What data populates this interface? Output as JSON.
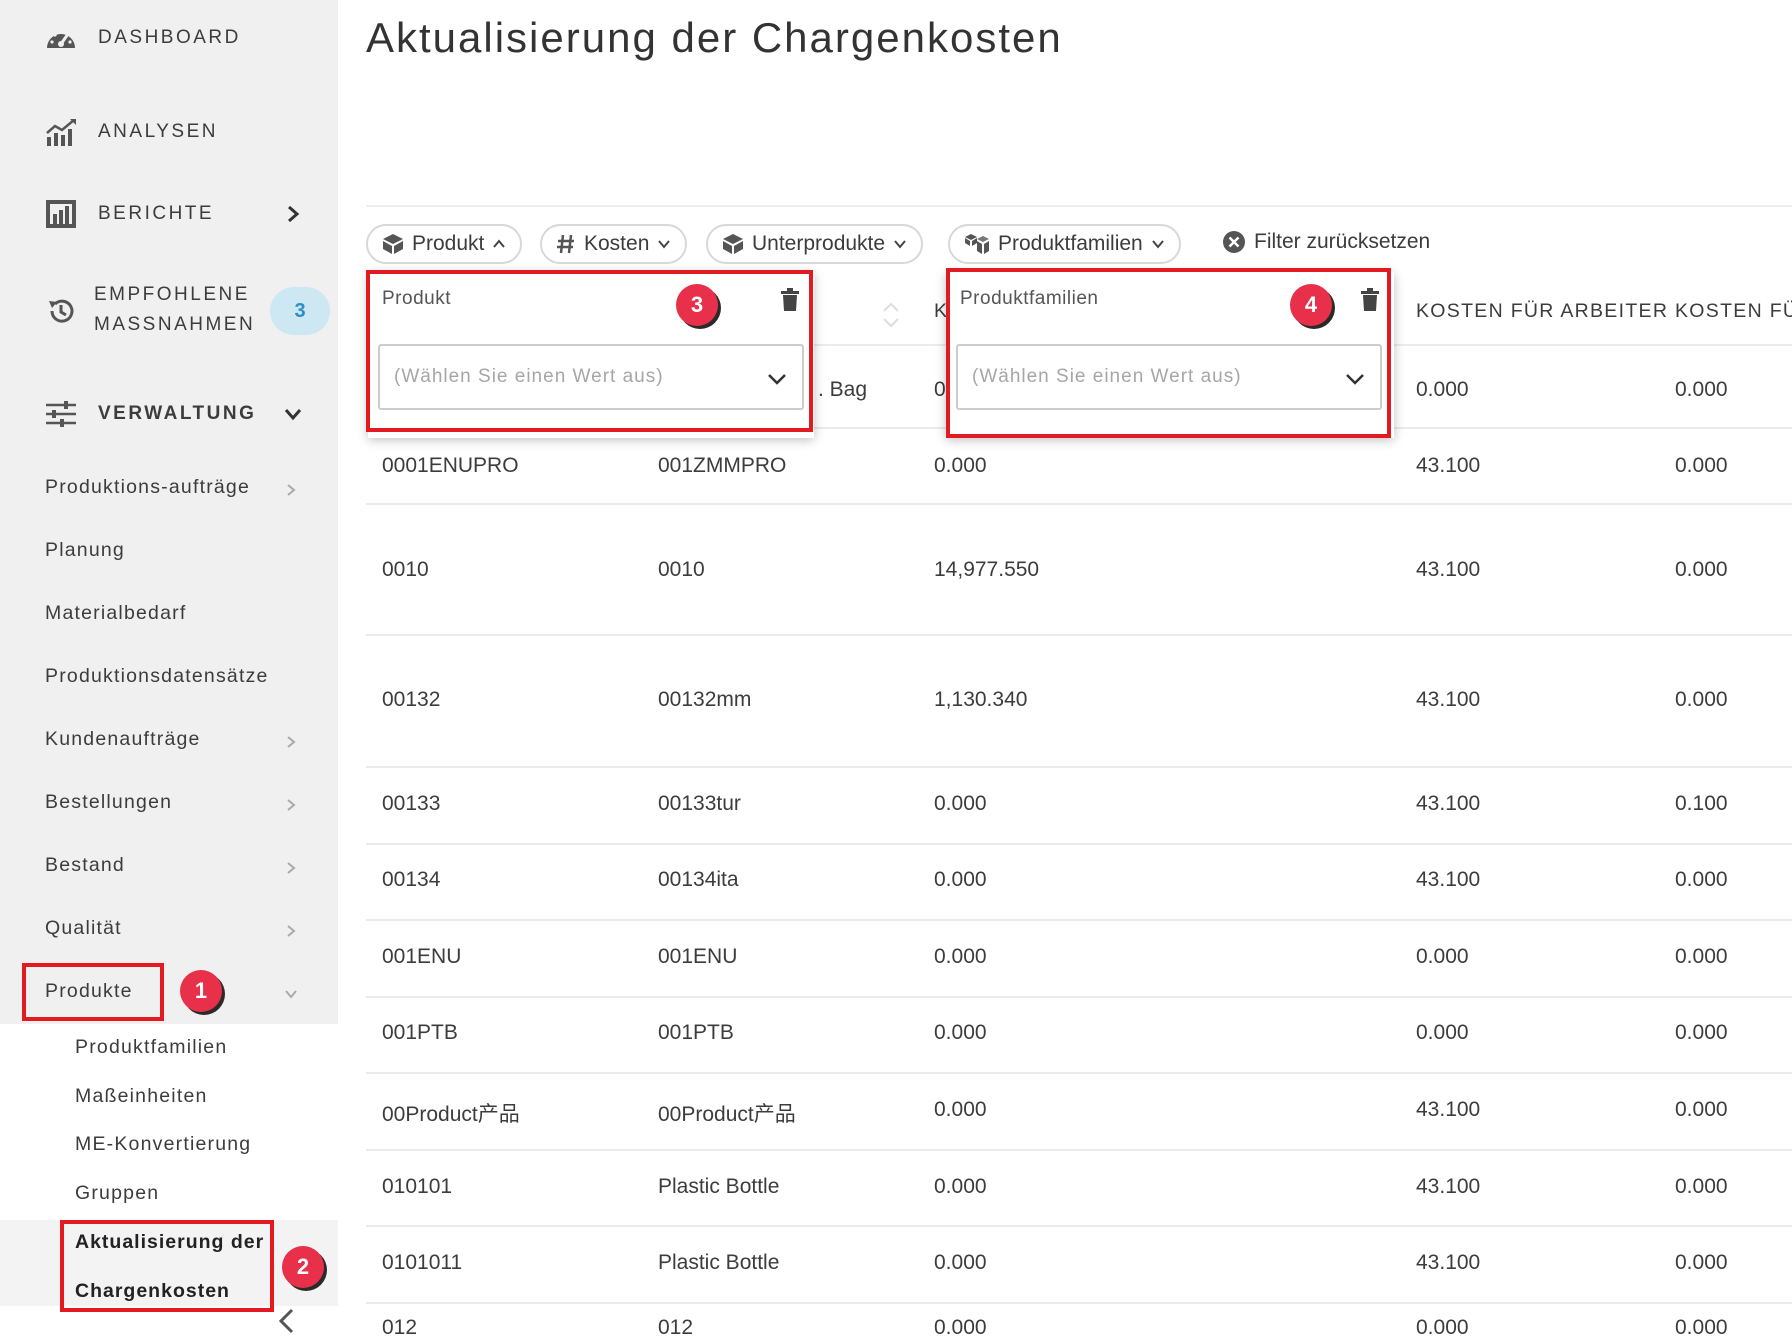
{
  "page": {
    "title": "Aktualisierung der Chargenkosten"
  },
  "sidebar": {
    "top_items": [
      {
        "label": "DASHBOARD",
        "icon": "gauge-icon"
      },
      {
        "label": "ANALYSEN",
        "icon": "analytics-icon"
      },
      {
        "label": "BERICHTE",
        "icon": "reports-icon"
      },
      {
        "label_line1": "EMPFOHLENE",
        "label_line2": "MASSNAHMEN",
        "icon": "history-icon",
        "badge": "3"
      },
      {
        "label": "VERWALTUNG",
        "icon": "sliders-icon"
      }
    ],
    "items": [
      "Produktions-aufträge",
      "Planung",
      "Materialbedarf",
      "Produktionsdatensätze",
      "Kundenaufträge",
      "Bestellungen",
      "Bestand",
      "Qualität",
      "Produkte"
    ],
    "sub_items": [
      "Produktfamilien",
      "Maßeinheiten",
      "ME-Konvertierung",
      "Gruppen"
    ],
    "active_sub_line1": "Aktualisierung der",
    "active_sub_line2": "Chargenkosten"
  },
  "filters": {
    "chips": [
      {
        "label": "Produkt",
        "icon": "cube-icon",
        "state": "expanded"
      },
      {
        "label": "Kosten",
        "icon": "hash-icon",
        "state": "collapsed"
      },
      {
        "label": "Unterprodukte",
        "icon": "cube-icon",
        "state": "collapsed"
      },
      {
        "label": "Produktfamilien",
        "icon": "cubes-icon",
        "state": "collapsed"
      }
    ],
    "reset_label": "Filter zurücksetzen"
  },
  "popovers": {
    "produkt": {
      "title": "Produkt",
      "placeholder": "(Wählen Sie einen Wert aus)"
    },
    "produktfamilien": {
      "title": "Produktfamilien",
      "placeholder": "(Wählen Sie einen Wert aus)"
    }
  },
  "table": {
    "headers": {
      "col3_fragment": "K",
      "col4": "KOSTEN FÜR ARBEITER",
      "col5": "KOSTEN FÜR"
    },
    "first_row": {
      "col2_fragment": ". Bag",
      "col3_fragment": "0",
      "col4": "0.000",
      "col5": "0.000"
    },
    "rows": [
      {
        "c1": "0001ENUPRO",
        "c2": "001ZMMPRO",
        "c3": "0.000",
        "c4": "43.100",
        "c5": "0.000"
      },
      {
        "c1": "0010",
        "c2": "0010",
        "c3": "14,977.550",
        "c4": "43.100",
        "c5": "0.000"
      },
      {
        "c1": "00132",
        "c2": "00132mm",
        "c3": "1,130.340",
        "c4": "43.100",
        "c5": "0.000"
      },
      {
        "c1": "00133",
        "c2": "00133tur",
        "c3": "0.000",
        "c4": "43.100",
        "c5": "0.100"
      },
      {
        "c1": "00134",
        "c2": "00134ita",
        "c3": "0.000",
        "c4": "43.100",
        "c5": "0.000"
      },
      {
        "c1": "001ENU",
        "c2": "001ENU",
        "c3": "0.000",
        "c4": "0.000",
        "c5": "0.000"
      },
      {
        "c1": "001PTB",
        "c2": "001PTB",
        "c3": "0.000",
        "c4": "0.000",
        "c5": "0.000"
      },
      {
        "c1": "00Product产品",
        "c2": "00Product产品",
        "c3": "0.000",
        "c4": "43.100",
        "c5": "0.000"
      },
      {
        "c1": "010101",
        "c2": "Plastic Bottle",
        "c3": "0.000",
        "c4": "43.100",
        "c5": "0.000"
      },
      {
        "c1": "0101011",
        "c2": "Plastic Bottle",
        "c3": "0.000",
        "c4": "43.100",
        "c5": "0.000"
      },
      {
        "c1": "012",
        "c2": "012",
        "c3": "0.000",
        "c4": "0.000",
        "c5": "0.000"
      }
    ]
  },
  "annotations": [
    "1",
    "2",
    "3",
    "4"
  ],
  "colors": {
    "annotation_red": "#e21b23",
    "badge_bg": "#cde7f3",
    "badge_text": "#2e8ec4",
    "sidebar_bg": "#f0f0f0"
  }
}
